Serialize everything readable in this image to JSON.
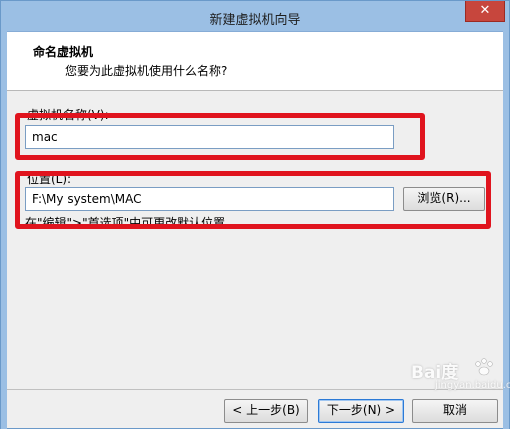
{
  "window": {
    "title": "新建虚拟机向导",
    "close_glyph": "✕"
  },
  "header": {
    "title": "命名虚拟机",
    "subtitle": "您要为此虚拟机使用什么名称?"
  },
  "vm_name": {
    "label": "虚拟机名称(V):",
    "value": "mac"
  },
  "location": {
    "label": "位置(L):",
    "value": "F:\\My system\\MAC",
    "browse_label": "浏览(R)...",
    "hint": "在\"编辑\">\"首选项\"中可更改默认位置。"
  },
  "footer": {
    "back_label": "< 上一步(B)",
    "next_label": "下一步(N) >",
    "cancel_label": "取消"
  },
  "watermark": {
    "logo": "Bai度",
    "text": "jingyan.baidu.com"
  },
  "colors": {
    "annotation_red": "#e0141e",
    "titlebar": "#9bbfe4",
    "close": "#c7463d"
  }
}
